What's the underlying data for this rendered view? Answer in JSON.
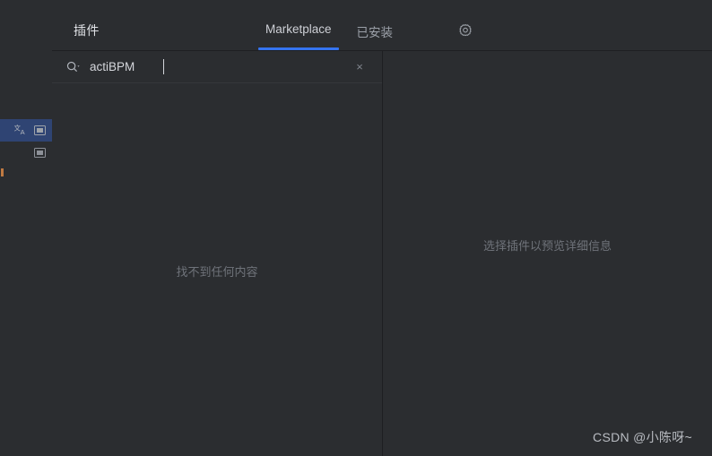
{
  "window": {
    "background_color": "#2b2d30",
    "border_color": "#1e1f22"
  },
  "ide_background": {
    "selected_row_color": "#2f4473",
    "icons": [
      {
        "name": "translate-icon",
        "glyph": "文A"
      },
      {
        "name": "window-icon",
        "glyph": "▣"
      },
      {
        "name": "window-icon",
        "glyph": "▣"
      }
    ]
  },
  "dialog": {
    "title": "插件",
    "tabs": [
      {
        "label": "Marketplace",
        "active": true
      },
      {
        "label": "已安装",
        "active": false
      }
    ],
    "active_tab_underline_color": "#3574f0",
    "settings_icon": "gear-icon"
  },
  "search": {
    "value": "actiBPM",
    "placeholder": "",
    "icon": "search-icon",
    "clear_icon": "×",
    "clear_label": "Clear search"
  },
  "left_panel": {
    "empty_message": "找不到任何内容"
  },
  "right_panel": {
    "empty_message": "选择插件以预览详细信息"
  },
  "watermark": {
    "text": "CSDN @小陈呀~"
  }
}
